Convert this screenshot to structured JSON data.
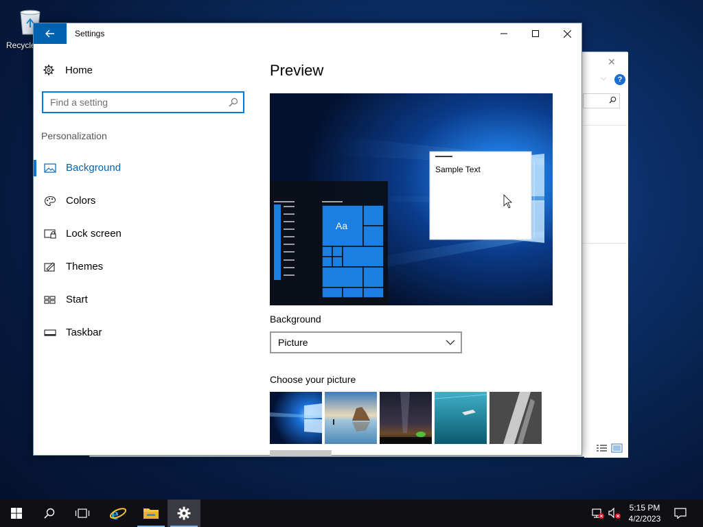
{
  "desktop": {
    "icons": [
      {
        "label": "Recycle Bin",
        "icon": "recycle-bin-icon"
      }
    ]
  },
  "window": {
    "title": "Settings"
  },
  "sidebar": {
    "home_label": "Home",
    "search_placeholder": "Find a setting",
    "section": "Personalization",
    "items": [
      {
        "label": "Background",
        "icon": "picture-icon",
        "active": true
      },
      {
        "label": "Colors",
        "icon": "palette-icon",
        "active": false
      },
      {
        "label": "Lock screen",
        "icon": "lock-screen-icon",
        "active": false
      },
      {
        "label": "Themes",
        "icon": "themes-icon",
        "active": false
      },
      {
        "label": "Start",
        "icon": "start-icon",
        "active": false
      },
      {
        "label": "Taskbar",
        "icon": "taskbar-icon",
        "active": false
      }
    ]
  },
  "main": {
    "preview_heading": "Preview",
    "preview_tile_label": "Aa",
    "preview_sample_text": "Sample Text",
    "background_label": "Background",
    "background_value": "Picture",
    "choose_picture_label": "Choose your picture"
  },
  "taskbar": {
    "time": "5:15 PM",
    "date": "4/2/2023"
  },
  "colors": {
    "accent": "#0078d7",
    "accent_dark": "#0063b1",
    "taskbar": "#0f0f14"
  }
}
